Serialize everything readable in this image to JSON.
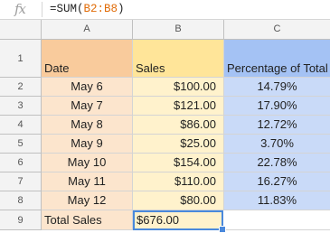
{
  "formula_bar": {
    "icon": "fx-icon",
    "formula_prefix": "=SUM(",
    "formula_range": "B2:B8",
    "formula_suffix": ")"
  },
  "columns": [
    "A",
    "B",
    "C"
  ],
  "rows": [
    "1",
    "2",
    "3",
    "4",
    "5",
    "6",
    "7",
    "8",
    "9"
  ],
  "headers": {
    "date": "Date",
    "sales": "Sales",
    "percentage": "Percentage of Total"
  },
  "data_rows": [
    {
      "date": "May 6",
      "sales": "$100.00",
      "pct": "14.79%"
    },
    {
      "date": "May 7",
      "sales": "$121.00",
      "pct": "17.90%"
    },
    {
      "date": "May 8",
      "sales": "$86.00",
      "pct": "12.72%"
    },
    {
      "date": "May 9",
      "sales": "$25.00",
      "pct": "3.70%"
    },
    {
      "date": "May 10",
      "sales": "$154.00",
      "pct": "22.78%"
    },
    {
      "date": "May 11",
      "sales": "$110.00",
      "pct": "16.27%"
    },
    {
      "date": "May 12",
      "sales": "$80.00",
      "pct": "11.83%"
    }
  ],
  "total_row": {
    "label": "Total Sales",
    "value": "$676.00",
    "pct": ""
  },
  "selected_cell": "B9",
  "colors": {
    "col_a_header": "#f9cb9c",
    "col_b_header": "#ffe599",
    "col_c_header": "#a4c2f4",
    "col_a_data": "#fce5cd",
    "col_b_data": "#fff2cc",
    "col_c_data": "#c9daf8",
    "selection": "#4a89dc"
  }
}
